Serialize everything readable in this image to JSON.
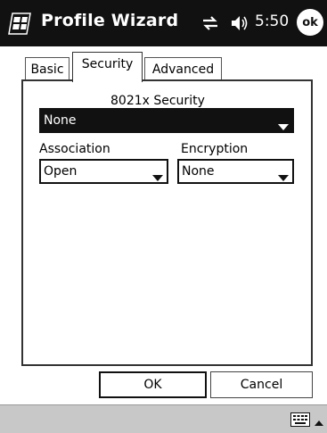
{
  "titlebar": {
    "title": "Profile Wizard",
    "clock": "5:50",
    "ok_label": "ok",
    "icons": [
      "windows-start-icon",
      "connectivity-icon",
      "volume-icon"
    ]
  },
  "tabs": [
    {
      "label": "Basic"
    },
    {
      "label": "Security",
      "selected": true
    },
    {
      "label": "Advanced"
    }
  ],
  "security": {
    "label": "8021x Security",
    "value": "None"
  },
  "association": {
    "label": "Association",
    "value": "Open"
  },
  "encryption": {
    "label": "Encryption",
    "value": "None"
  },
  "buttons": {
    "ok": "OK",
    "cancel": "Cancel"
  },
  "bottombar": {
    "icons": [
      "keyboard-icon",
      "sip-arrow-icon"
    ]
  }
}
